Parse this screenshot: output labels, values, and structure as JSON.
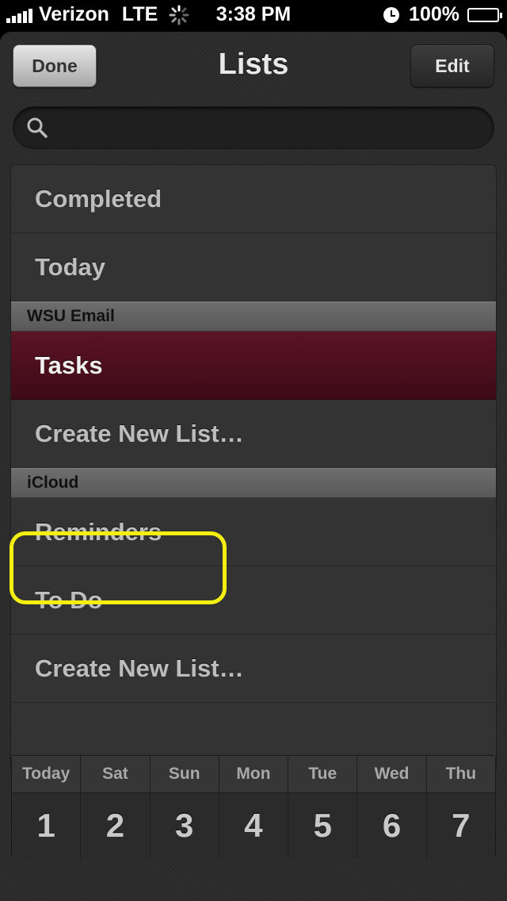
{
  "status_bar": {
    "carrier": "Verizon",
    "network": "LTE",
    "time": "3:38 PM",
    "battery": "100%"
  },
  "nav": {
    "done_label": "Done",
    "title": "Lists",
    "edit_label": "Edit"
  },
  "search": {
    "value": "",
    "placeholder": ""
  },
  "lists": {
    "completed": "Completed",
    "today": "Today",
    "section_wsu": "WSU Email",
    "tasks": "Tasks",
    "create_new_wsu": "Create New List…",
    "section_icloud": "iCloud",
    "reminders": "Reminders",
    "todo": "To Do",
    "create_new_icloud": "Create New List…"
  },
  "calendar": {
    "days": [
      {
        "name": "Today",
        "num": "1"
      },
      {
        "name": "Sat",
        "num": "2"
      },
      {
        "name": "Sun",
        "num": "3"
      },
      {
        "name": "Mon",
        "num": "4"
      },
      {
        "name": "Tue",
        "num": "5"
      },
      {
        "name": "Wed",
        "num": "6"
      },
      {
        "name": "Thu",
        "num": "7"
      }
    ]
  },
  "colors": {
    "selected_row": "#5b1424",
    "highlight": "#f4ef13"
  },
  "icons": [
    "signal-icon",
    "loading-spinner-icon",
    "alarm-icon",
    "battery-icon",
    "search-icon"
  ]
}
